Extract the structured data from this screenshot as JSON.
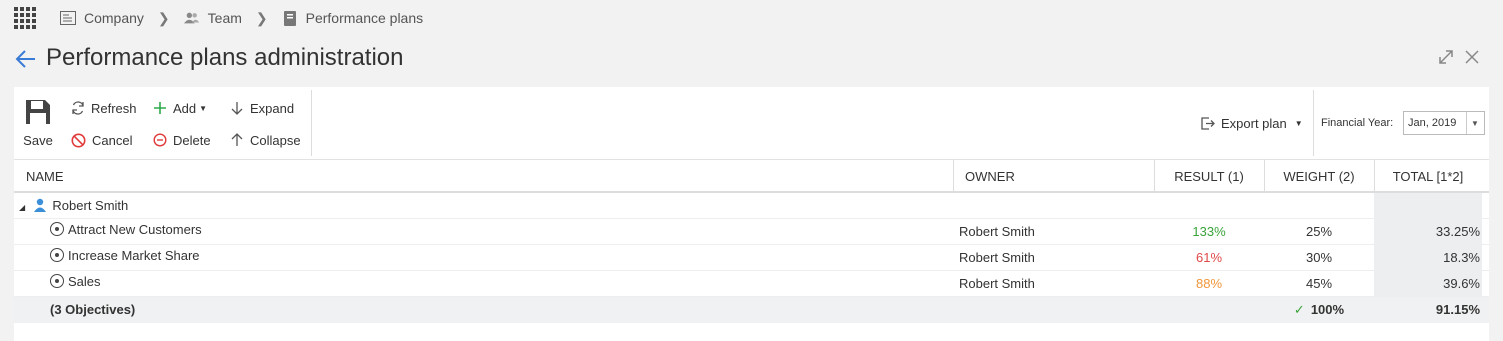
{
  "breadcrumb": {
    "items": [
      {
        "label": "Company",
        "icon": "company-icon"
      },
      {
        "label": "Team",
        "icon": "team-icon"
      },
      {
        "label": "Performance plans",
        "icon": "document-icon"
      }
    ]
  },
  "page": {
    "title": "Performance plans administration"
  },
  "toolbar": {
    "save": "Save",
    "refresh": "Refresh",
    "cancel": "Cancel",
    "add": "Add",
    "delete": "Delete",
    "expand": "Expand",
    "collapse": "Collapse",
    "export": "Export plan",
    "financial_year_label": "Financial Year:",
    "financial_year_value": "Jan, 2019"
  },
  "table": {
    "columns": [
      "NAME",
      "OWNER",
      "RESULT (1)",
      "WEIGHT (2)",
      "TOTAL [1*2]"
    ],
    "group": {
      "name": "Robert Smith"
    },
    "rows": [
      {
        "name": "Attract New Customers",
        "owner": "Robert Smith",
        "result": "133%",
        "result_color": "#3aa33a",
        "weight": "25%",
        "total": "33.25%"
      },
      {
        "name": "Increase Market Share",
        "owner": "Robert Smith",
        "result": "61%",
        "result_color": "#e04848",
        "weight": "30%",
        "total": "18.3%"
      },
      {
        "name": "Sales",
        "owner": "Robert Smith",
        "result": "88%",
        "result_color": "#f0963a",
        "weight": "45%",
        "total": "39.6%"
      }
    ],
    "summary": {
      "label": "(3 Objectives)",
      "weight": "100%",
      "total": "91.15%"
    }
  }
}
